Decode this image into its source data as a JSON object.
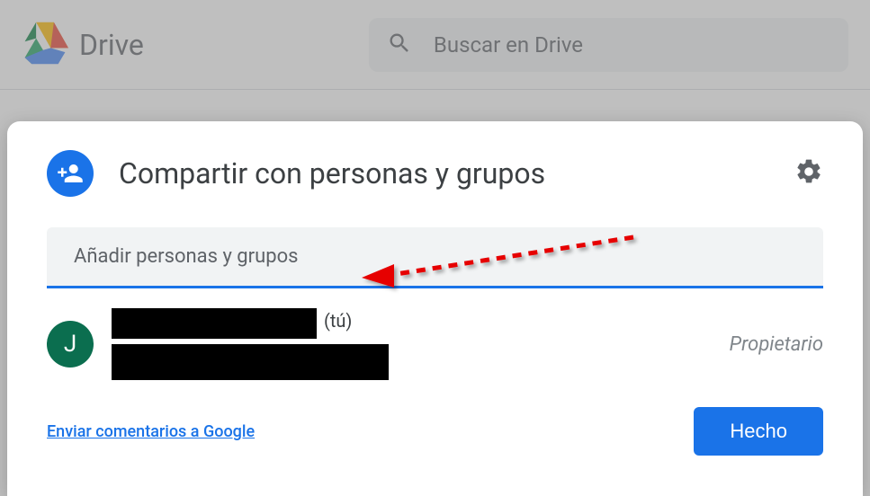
{
  "header": {
    "app_name": "Drive",
    "search_placeholder": "Buscar en Drive"
  },
  "dialog": {
    "title": "Compartir con personas y grupos",
    "add_placeholder": "Añadir personas y grupos",
    "user": {
      "avatar_initial": "J",
      "you_suffix": "(tú)",
      "role": "Propietario"
    },
    "feedback_label": "Enviar comentarios a Google",
    "done_label": "Hecho"
  },
  "colors": {
    "accent": "#1a73e8"
  }
}
